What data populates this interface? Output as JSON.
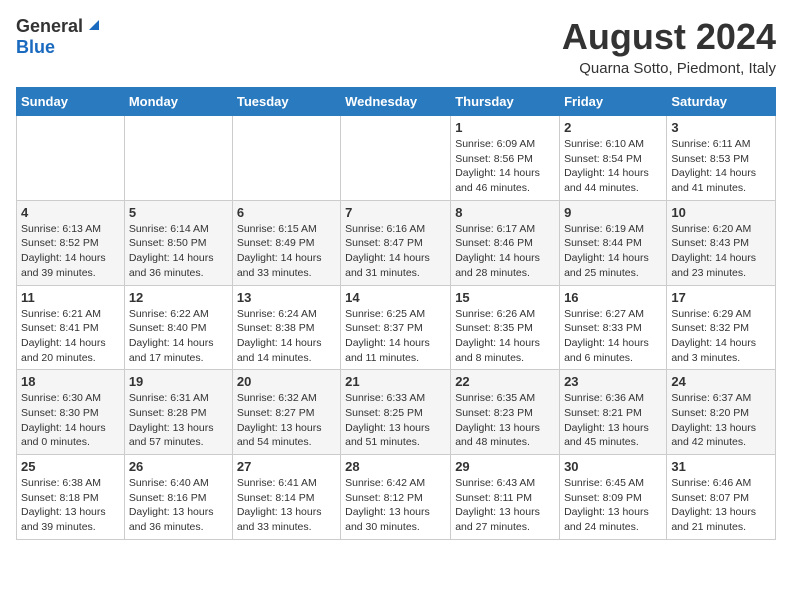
{
  "logo": {
    "general": "General",
    "blue": "Blue"
  },
  "title": "August 2024",
  "location": "Quarna Sotto, Piedmont, Italy",
  "days_of_week": [
    "Sunday",
    "Monday",
    "Tuesday",
    "Wednesday",
    "Thursday",
    "Friday",
    "Saturday"
  ],
  "weeks": [
    [
      {
        "day": "",
        "info": ""
      },
      {
        "day": "",
        "info": ""
      },
      {
        "day": "",
        "info": ""
      },
      {
        "day": "",
        "info": ""
      },
      {
        "day": "1",
        "info": "Sunrise: 6:09 AM\nSunset: 8:56 PM\nDaylight: 14 hours and 46 minutes."
      },
      {
        "day": "2",
        "info": "Sunrise: 6:10 AM\nSunset: 8:54 PM\nDaylight: 14 hours and 44 minutes."
      },
      {
        "day": "3",
        "info": "Sunrise: 6:11 AM\nSunset: 8:53 PM\nDaylight: 14 hours and 41 minutes."
      }
    ],
    [
      {
        "day": "4",
        "info": "Sunrise: 6:13 AM\nSunset: 8:52 PM\nDaylight: 14 hours and 39 minutes."
      },
      {
        "day": "5",
        "info": "Sunrise: 6:14 AM\nSunset: 8:50 PM\nDaylight: 14 hours and 36 minutes."
      },
      {
        "day": "6",
        "info": "Sunrise: 6:15 AM\nSunset: 8:49 PM\nDaylight: 14 hours and 33 minutes."
      },
      {
        "day": "7",
        "info": "Sunrise: 6:16 AM\nSunset: 8:47 PM\nDaylight: 14 hours and 31 minutes."
      },
      {
        "day": "8",
        "info": "Sunrise: 6:17 AM\nSunset: 8:46 PM\nDaylight: 14 hours and 28 minutes."
      },
      {
        "day": "9",
        "info": "Sunrise: 6:19 AM\nSunset: 8:44 PM\nDaylight: 14 hours and 25 minutes."
      },
      {
        "day": "10",
        "info": "Sunrise: 6:20 AM\nSunset: 8:43 PM\nDaylight: 14 hours and 23 minutes."
      }
    ],
    [
      {
        "day": "11",
        "info": "Sunrise: 6:21 AM\nSunset: 8:41 PM\nDaylight: 14 hours and 20 minutes."
      },
      {
        "day": "12",
        "info": "Sunrise: 6:22 AM\nSunset: 8:40 PM\nDaylight: 14 hours and 17 minutes."
      },
      {
        "day": "13",
        "info": "Sunrise: 6:24 AM\nSunset: 8:38 PM\nDaylight: 14 hours and 14 minutes."
      },
      {
        "day": "14",
        "info": "Sunrise: 6:25 AM\nSunset: 8:37 PM\nDaylight: 14 hours and 11 minutes."
      },
      {
        "day": "15",
        "info": "Sunrise: 6:26 AM\nSunset: 8:35 PM\nDaylight: 14 hours and 8 minutes."
      },
      {
        "day": "16",
        "info": "Sunrise: 6:27 AM\nSunset: 8:33 PM\nDaylight: 14 hours and 6 minutes."
      },
      {
        "day": "17",
        "info": "Sunrise: 6:29 AM\nSunset: 8:32 PM\nDaylight: 14 hours and 3 minutes."
      }
    ],
    [
      {
        "day": "18",
        "info": "Sunrise: 6:30 AM\nSunset: 8:30 PM\nDaylight: 14 hours and 0 minutes."
      },
      {
        "day": "19",
        "info": "Sunrise: 6:31 AM\nSunset: 8:28 PM\nDaylight: 13 hours and 57 minutes."
      },
      {
        "day": "20",
        "info": "Sunrise: 6:32 AM\nSunset: 8:27 PM\nDaylight: 13 hours and 54 minutes."
      },
      {
        "day": "21",
        "info": "Sunrise: 6:33 AM\nSunset: 8:25 PM\nDaylight: 13 hours and 51 minutes."
      },
      {
        "day": "22",
        "info": "Sunrise: 6:35 AM\nSunset: 8:23 PM\nDaylight: 13 hours and 48 minutes."
      },
      {
        "day": "23",
        "info": "Sunrise: 6:36 AM\nSunset: 8:21 PM\nDaylight: 13 hours and 45 minutes."
      },
      {
        "day": "24",
        "info": "Sunrise: 6:37 AM\nSunset: 8:20 PM\nDaylight: 13 hours and 42 minutes."
      }
    ],
    [
      {
        "day": "25",
        "info": "Sunrise: 6:38 AM\nSunset: 8:18 PM\nDaylight: 13 hours and 39 minutes."
      },
      {
        "day": "26",
        "info": "Sunrise: 6:40 AM\nSunset: 8:16 PM\nDaylight: 13 hours and 36 minutes."
      },
      {
        "day": "27",
        "info": "Sunrise: 6:41 AM\nSunset: 8:14 PM\nDaylight: 13 hours and 33 minutes."
      },
      {
        "day": "28",
        "info": "Sunrise: 6:42 AM\nSunset: 8:12 PM\nDaylight: 13 hours and 30 minutes."
      },
      {
        "day": "29",
        "info": "Sunrise: 6:43 AM\nSunset: 8:11 PM\nDaylight: 13 hours and 27 minutes."
      },
      {
        "day": "30",
        "info": "Sunrise: 6:45 AM\nSunset: 8:09 PM\nDaylight: 13 hours and 24 minutes."
      },
      {
        "day": "31",
        "info": "Sunrise: 6:46 AM\nSunset: 8:07 PM\nDaylight: 13 hours and 21 minutes."
      }
    ]
  ]
}
